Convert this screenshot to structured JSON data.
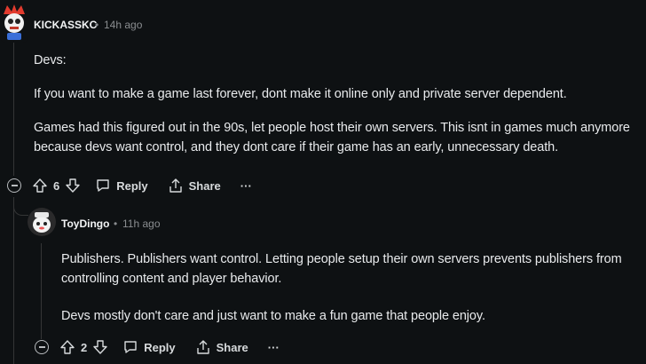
{
  "comment1": {
    "username": "KICKASSKC",
    "time": "14h ago",
    "paragraphs": [
      "Devs:",
      "If you want to make a game last forever, dont make it online only and private server dependent.",
      "Games had this figured out in the 90s, let people host their own servers. This isnt in games much anymore because devs want control, and they dont care if their game has an early, unnecessary death."
    ],
    "votes": "6",
    "reply_label": "Reply",
    "share_label": "Share",
    "more_label": "···"
  },
  "comment2": {
    "username": "ToyDingo",
    "time": "11h ago",
    "paragraphs": [
      "Publishers. Publishers want control. Letting people setup their own servers prevents publishers from controlling content and player behavior.",
      "Devs mostly don't care and just want to make a fun game that people enjoy."
    ],
    "votes": "2",
    "reply_label": "Reply",
    "share_label": "Share",
    "more_label": "···"
  },
  "separator": "•",
  "colors": {
    "background": "#0e1113",
    "text": "#d7dadc",
    "muted": "#8a8d90",
    "thread_line": "#343536"
  }
}
